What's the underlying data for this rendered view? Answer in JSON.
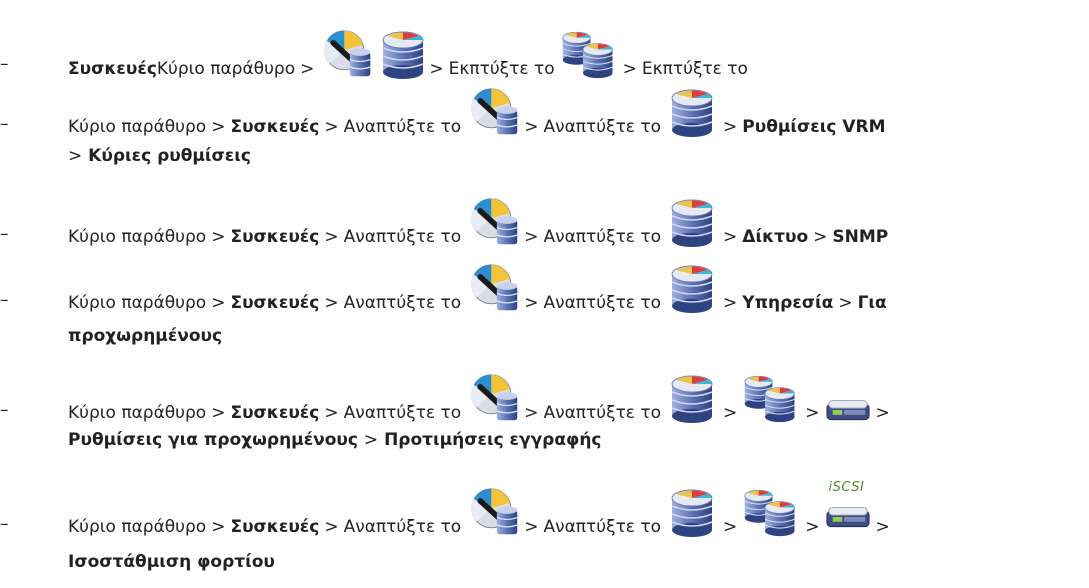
{
  "sep": ">",
  "dash": "–",
  "lines": [
    {
      "bold1": "Συσκευές",
      "t1": "Κύριο παράθυρο",
      "t2": "Εκπτύξτε το",
      "t3": "Εκπτύξτε το"
    },
    {
      "t1": "Κύριο παράθυρο",
      "bold1": "Συσκευές",
      "t2": "Αναπτύξτε το",
      "t3": "Αναπτύξτε το",
      "bold2": "Ρυθμίσεις VRM",
      "bold3": "Κύριες ρυθμίσεις"
    },
    {
      "t1": "Κύριο παράθυρο",
      "bold1": "Συσκευές",
      "t2": "Αναπτύξτε το",
      "t3": "Αναπτύξτε το",
      "bold2": "Δίκτυο",
      "bold3": "SNMP"
    },
    {
      "t1": "Κύριο παράθυρο",
      "bold1": "Συσκευές",
      "t2": "Αναπτύξτε το",
      "t3": "Αναπτύξτε το",
      "bold2": "Υπηρεσία",
      "bold3": "Για",
      "bold4": "προχωρημένους"
    },
    {
      "t1": "Κύριο παράθυρο",
      "bold1": "Συσκευές",
      "t2": "Αναπτύξτε το",
      "t3": "Αναπτύξτε το",
      "bold2": "Ρυθμίσεις για προχωρημένους",
      "bold3": "Προτιμήσεις εγγραφής"
    },
    {
      "t1": "Κύριο παράθυρο",
      "bold1": "Συσκευές",
      "t2": "Αναπτύξτε το",
      "t3": "Αναπτύξτε το",
      "bold2": "Ισοστάθμιση φορτίου",
      "badge": "iSCSI"
    }
  ],
  "icons": {
    "vrm": "vrm-server-icon",
    "pool": "storage-pool-icon",
    "dbpair": "database-pair-icon",
    "device": "storage-device-icon",
    "iscsi": "iscsi-device-icon"
  }
}
